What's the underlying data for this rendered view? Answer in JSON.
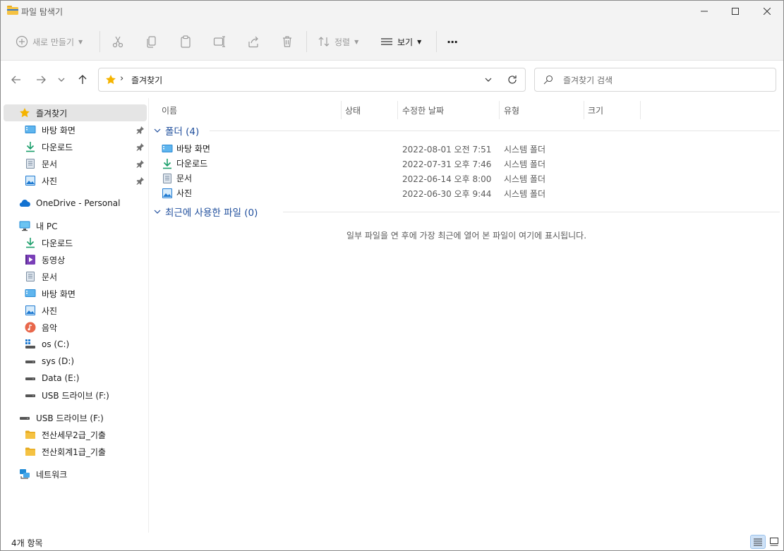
{
  "window": {
    "title": "파일 탐색기"
  },
  "commandbar": {
    "new_label": "새로 만들기",
    "sort_label": "정렬",
    "view_label": "보기",
    "more_label": "···"
  },
  "address": {
    "path": "즐겨찾기",
    "search_placeholder": "즐겨찾기 검색"
  },
  "sidebar": {
    "favorites": "즐겨찾기",
    "pinned": [
      "바탕 화면",
      "다운로드",
      "문서",
      "사진"
    ],
    "onedrive": "OneDrive - Personal",
    "thispc": "내 PC",
    "pc_items": [
      "다운로드",
      "동영상",
      "문서",
      "바탕 화면",
      "사진",
      "음악",
      "os (C:)",
      "sys (D:)",
      "Data (E:)",
      "USB 드라이브 (F:)"
    ],
    "usb": "USB 드라이브 (F:)",
    "usb_folders": [
      "전산세무2급_기출",
      "전산회계1급_기출"
    ],
    "network": "네트워크"
  },
  "columns": {
    "name": "이름",
    "status": "상태",
    "modified": "수정한 날짜",
    "type": "유형",
    "size": "크기"
  },
  "groups": {
    "folders": "폴더 (4)",
    "recent": "최근에 사용한 파일 (0)"
  },
  "folders": [
    {
      "name": "바탕 화면",
      "date": "2022-08-01 오전 7:51",
      "type": "시스템 폴더"
    },
    {
      "name": "다운로드",
      "date": "2022-07-31 오후 7:46",
      "type": "시스템 폴더"
    },
    {
      "name": "문서",
      "date": "2022-06-14 오후 8:00",
      "type": "시스템 폴더"
    },
    {
      "name": "사진",
      "date": "2022-06-30 오후 9:44",
      "type": "시스템 폴더"
    }
  ],
  "recent_empty_message": "일부 파일을 연 후에 가장 최근에 열어 본 파일이 여기에 표시됩니다.",
  "status": {
    "count": "4개 항목"
  },
  "colors": {
    "accent": "#1f4e9c",
    "folder_yellow": "#f5c242",
    "selection": "#e5e5e5"
  }
}
